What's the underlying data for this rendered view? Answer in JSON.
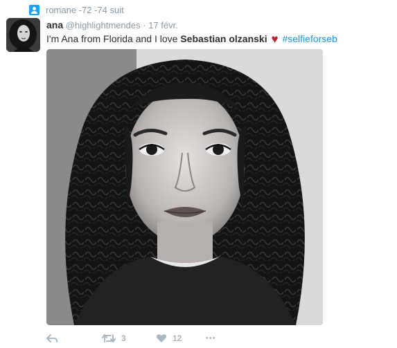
{
  "context": {
    "icon": "user-icon",
    "text": "romane -72 -74 suit"
  },
  "tweet": {
    "name": "ana",
    "handle": "@highlightmendes",
    "separator": "·",
    "timestamp": "17 févr.",
    "text_plain": "I'm Ana from Florida and I love ",
    "text_bold": "Sebastian olzanski",
    "heart": "♥",
    "hashtag": "#selfieforseb"
  },
  "actions": {
    "reply_icon": "reply-icon",
    "retweet_icon": "retweet-icon",
    "retweet_count": "3",
    "like_icon": "heart-icon",
    "like_count": "12",
    "more_icon": "more-icon",
    "more_label": "•••"
  },
  "colors": {
    "accent": "#1da1f2",
    "hashtag": "#1b95e0",
    "heart": "#c2232f",
    "muted": "#8899a6"
  }
}
